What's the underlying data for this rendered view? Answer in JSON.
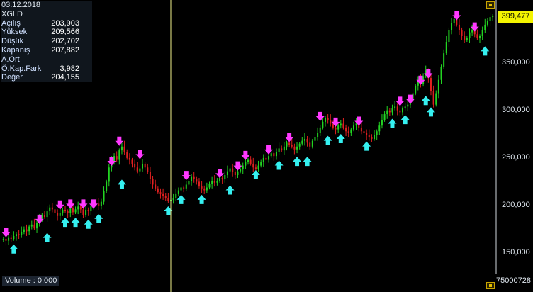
{
  "info_panel": {
    "date": "03.12.2018",
    "symbol": "XGLD",
    "rows": [
      {
        "label": "Açılış",
        "value": "203,903"
      },
      {
        "label": "Yüksek",
        "value": "209,566"
      },
      {
        "label": "Düşük",
        "value": "202,702"
      },
      {
        "label": "Kapanış",
        "value": "207,882"
      },
      {
        "label": "A.Ort",
        "value": ""
      },
      {
        "label": "Ö.Kap.Fark",
        "value": "3,982"
      },
      {
        "label": "Değer",
        "value": "204,155"
      }
    ]
  },
  "last_price_tag": "399,477",
  "volume_label": "Volume : 0,000",
  "volume_axis_value": "75000728",
  "colors": {
    "up": "#22d422",
    "down": "#e02020",
    "sell_arrow": "#ff39ff",
    "buy_arrow": "#35f0f0",
    "crosshair": "#f2f28c",
    "tag": "#f4f400"
  },
  "chart_data": {
    "type": "candlestick",
    "y_axis": {
      "ticks": [
        "150,000",
        "200,000",
        "250,000",
        "300,000",
        "350,000"
      ],
      "tick_values": [
        150,
        200,
        250,
        300,
        350
      ],
      "range": [
        130,
        410
      ]
    },
    "crosshair_index": 65,
    "series_close": [
      165,
      163,
      166,
      165,
      168,
      170,
      169,
      172,
      175,
      173,
      178,
      180,
      176,
      182,
      186,
      190,
      188,
      194,
      198,
      196,
      192,
      189,
      192,
      195,
      194,
      192,
      197,
      193,
      196,
      199,
      196,
      190,
      195,
      194,
      199,
      203,
      202,
      200,
      204,
      215,
      225,
      240,
      246,
      252,
      248,
      258,
      262,
      256,
      250,
      248,
      244,
      240,
      236,
      239,
      244,
      240,
      235,
      228,
      222,
      218,
      214,
      212,
      210,
      208,
      205,
      206,
      208,
      212,
      216,
      219,
      218,
      222,
      226,
      230,
      228,
      225,
      220,
      218,
      216,
      219,
      223,
      226,
      224,
      226,
      229,
      228,
      232,
      236,
      239,
      235,
      232,
      236,
      238,
      242,
      246,
      248,
      244,
      240,
      238,
      242,
      246,
      250,
      248,
      252,
      255,
      252,
      256,
      260,
      258,
      262,
      266,
      264,
      262,
      259,
      262,
      265,
      268,
      270,
      266,
      262,
      268,
      272,
      276,
      282,
      288,
      292,
      290,
      286,
      282,
      280,
      284,
      286,
      282,
      278,
      276,
      280,
      284,
      286,
      282,
      278,
      276,
      274,
      272,
      270,
      274,
      278,
      284,
      290,
      296,
      300,
      298,
      302,
      304,
      300,
      298,
      302,
      304,
      306,
      310,
      318,
      326,
      332,
      328,
      336,
      342,
      334,
      320,
      306,
      318,
      332,
      346,
      360,
      372,
      384,
      392,
      396,
      390,
      384,
      378,
      374,
      376,
      382,
      384,
      380,
      376,
      378,
      384,
      390,
      394,
      398,
      399
    ],
    "sell_signals": [
      {
        "i": 1,
        "v": 166
      },
      {
        "i": 14,
        "v": 180
      },
      {
        "i": 22,
        "v": 195
      },
      {
        "i": 26,
        "v": 196
      },
      {
        "i": 31,
        "v": 196
      },
      {
        "i": 35,
        "v": 196
      },
      {
        "i": 42,
        "v": 241
      },
      {
        "i": 45,
        "v": 262
      },
      {
        "i": 53,
        "v": 248
      },
      {
        "i": 71,
        "v": 226
      },
      {
        "i": 84,
        "v": 228
      },
      {
        "i": 91,
        "v": 236
      },
      {
        "i": 94,
        "v": 247
      },
      {
        "i": 103,
        "v": 253
      },
      {
        "i": 111,
        "v": 266
      },
      {
        "i": 123,
        "v": 288
      },
      {
        "i": 129,
        "v": 282
      },
      {
        "i": 138,
        "v": 283
      },
      {
        "i": 154,
        "v": 304
      },
      {
        "i": 158,
        "v": 306
      },
      {
        "i": 162,
        "v": 326
      },
      {
        "i": 165,
        "v": 333
      },
      {
        "i": 176,
        "v": 394
      },
      {
        "i": 183,
        "v": 382
      }
    ],
    "buy_signals": [
      {
        "i": 4,
        "v": 160
      },
      {
        "i": 17,
        "v": 172
      },
      {
        "i": 24,
        "v": 188
      },
      {
        "i": 28,
        "v": 188
      },
      {
        "i": 33,
        "v": 186
      },
      {
        "i": 37,
        "v": 192
      },
      {
        "i": 46,
        "v": 228
      },
      {
        "i": 64,
        "v": 200
      },
      {
        "i": 69,
        "v": 212
      },
      {
        "i": 77,
        "v": 212
      },
      {
        "i": 88,
        "v": 222
      },
      {
        "i": 98,
        "v": 238
      },
      {
        "i": 107,
        "v": 248
      },
      {
        "i": 114,
        "v": 252
      },
      {
        "i": 118,
        "v": 252
      },
      {
        "i": 126,
        "v": 274
      },
      {
        "i": 131,
        "v": 276
      },
      {
        "i": 141,
        "v": 268
      },
      {
        "i": 151,
        "v": 292
      },
      {
        "i": 156,
        "v": 296
      },
      {
        "i": 164,
        "v": 316
      },
      {
        "i": 166,
        "v": 304
      },
      {
        "i": 187,
        "v": 368
      }
    ]
  }
}
